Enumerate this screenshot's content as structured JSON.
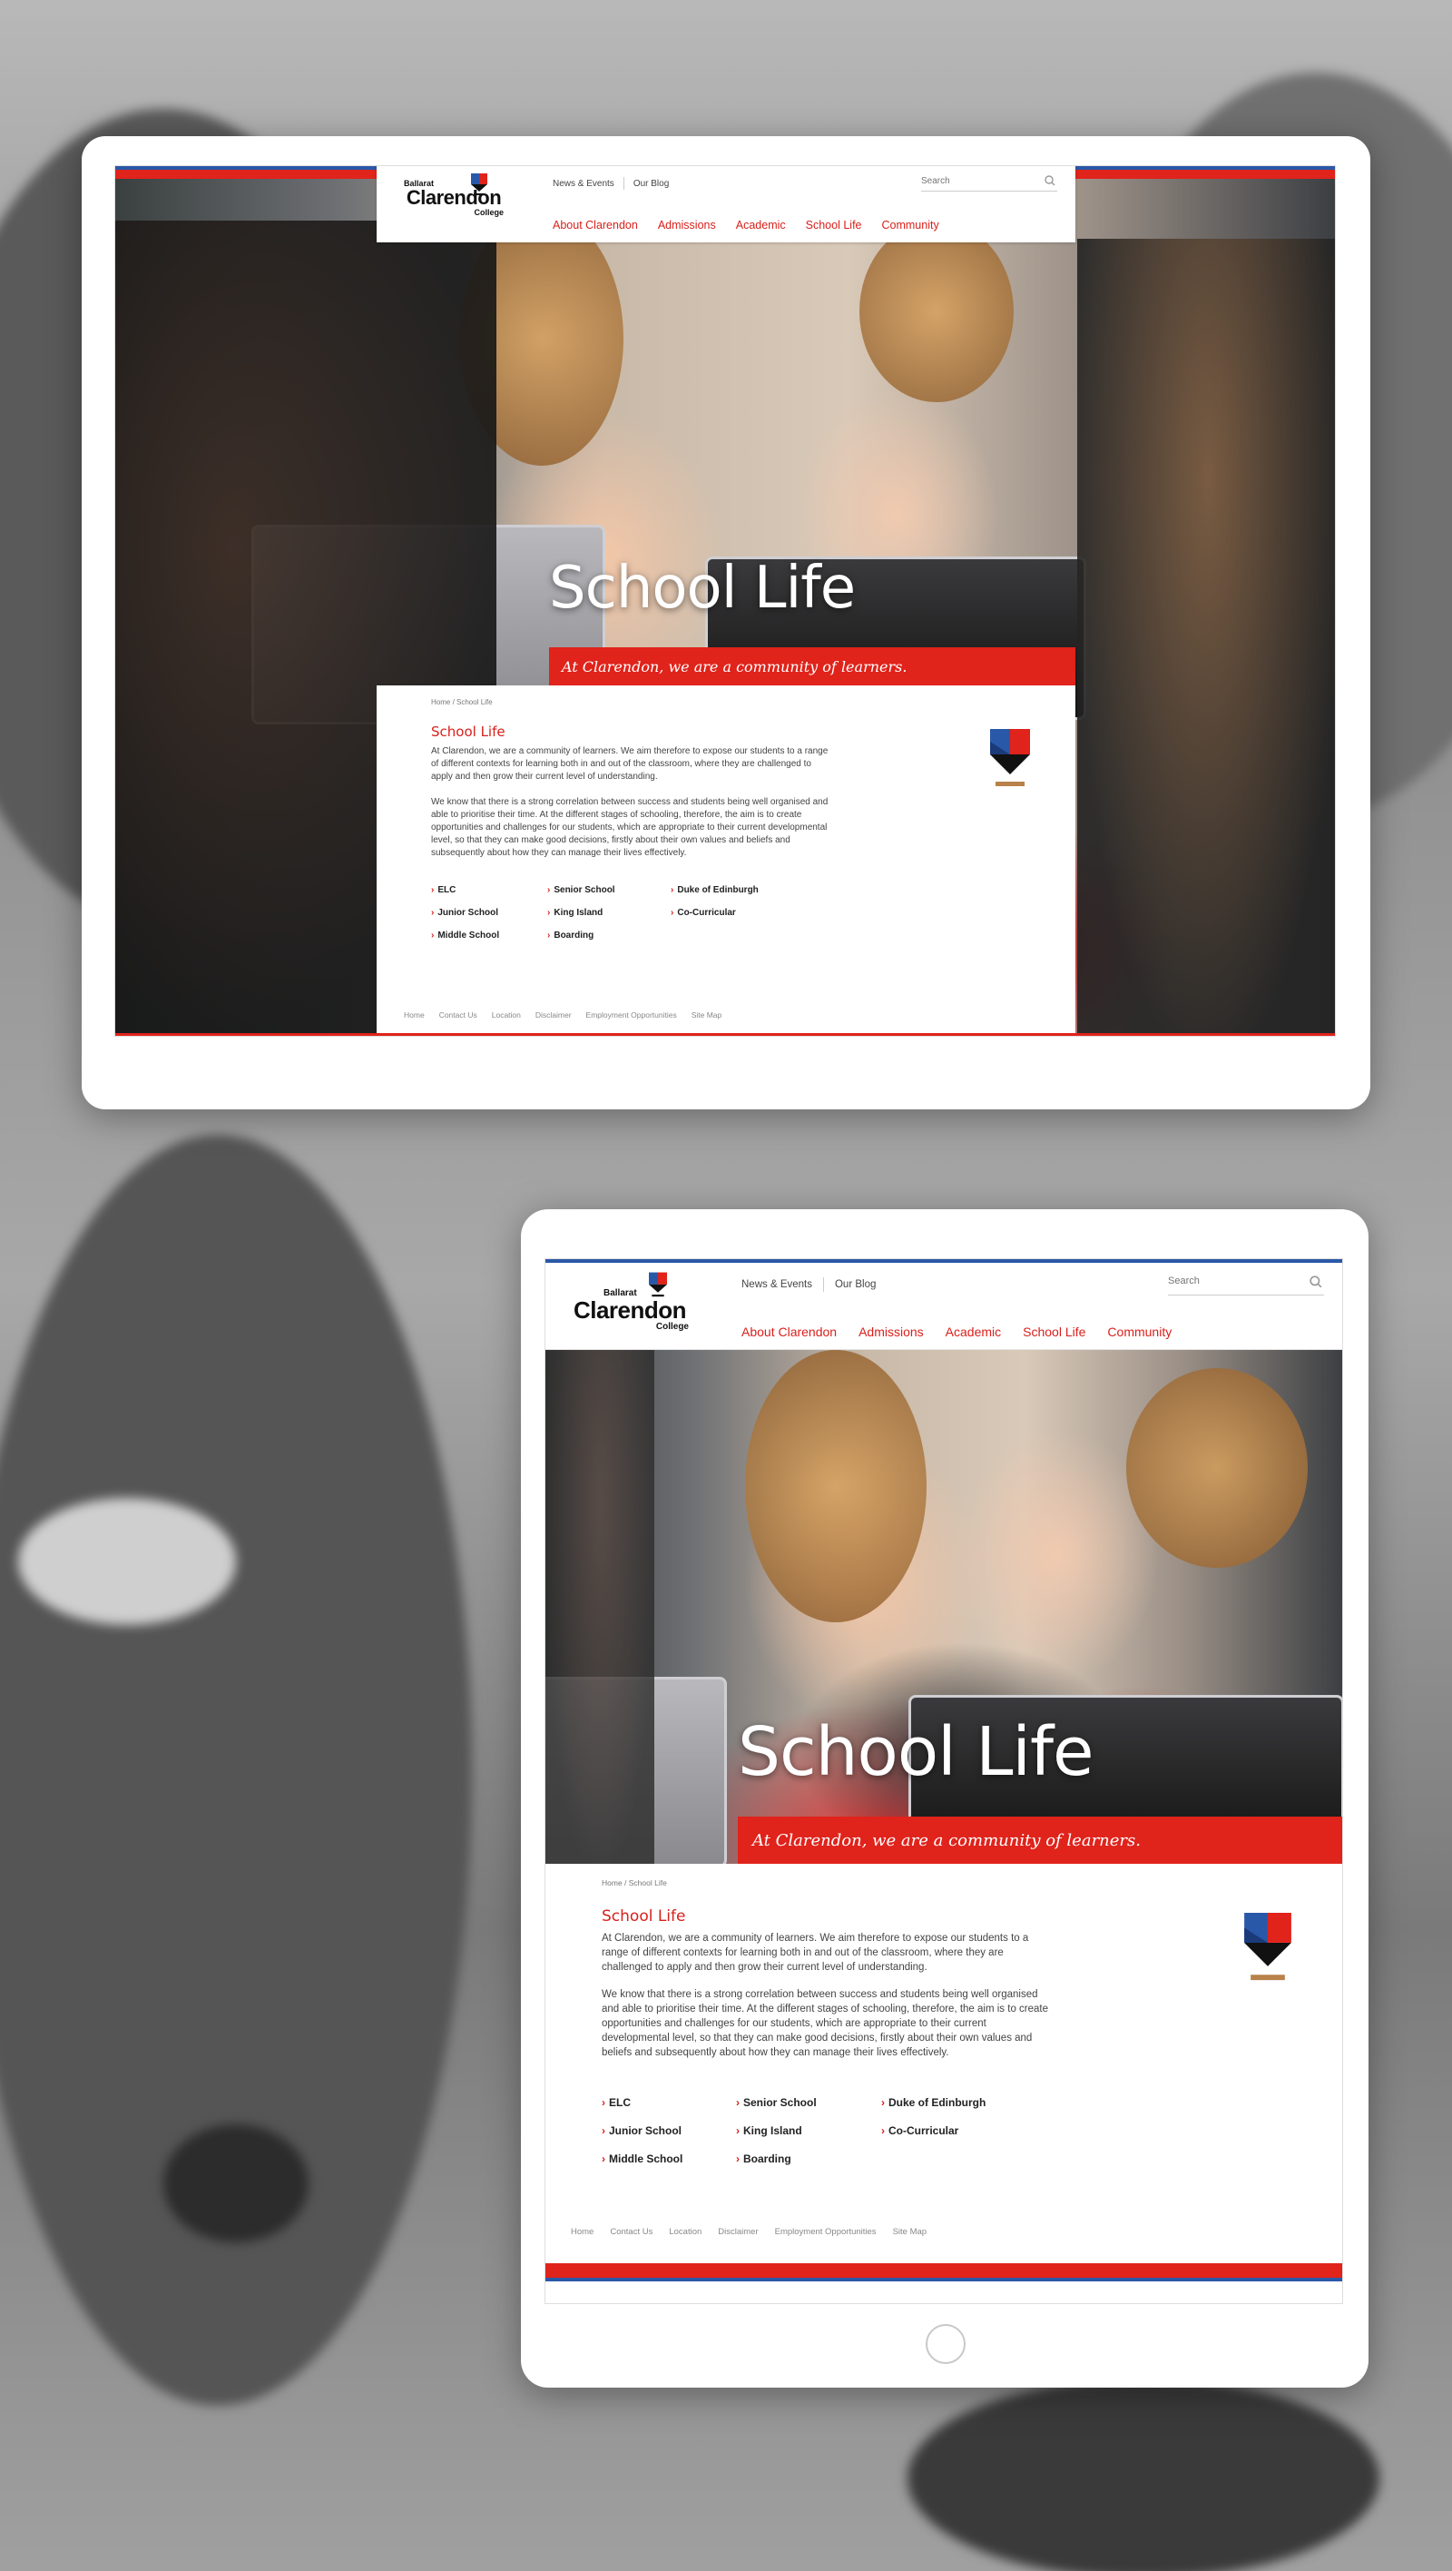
{
  "site": {
    "logo_top": "Ballarat",
    "logo_main": "Clarendon",
    "logo_bottom": "College",
    "utility_links": [
      "News & Events",
      "Our Blog"
    ],
    "search_placeholder": "Search",
    "main_nav": [
      "About Clarendon",
      "Admissions",
      "Academic",
      "School Life",
      "Community"
    ],
    "hero_title": "School Life",
    "hero_tagline": "At Clarendon, we are a community of learners.",
    "breadcrumb": "Home  /  School Life",
    "page_heading": "School Life",
    "paragraph_1": "At Clarendon, we are a community of learners. We aim therefore to expose our students to a range of different contexts for learning both in and out of the classroom, where they are challenged to apply and then grow their current level of understanding.",
    "paragraph_2": "We know that there is a strong correlation between success and students being well organised and able to prioritise their time. At the different stages of schooling, therefore, the aim is to create opportunities and challenges for our students, which are appropriate to their current developmental level, so that they can make good decisions, firstly about their own values and beliefs and subsequently about how they can manage their lives effectively.",
    "section_links": [
      "ELC",
      "Senior School",
      "Duke of Edinburgh",
      "Junior School",
      "King Island",
      "Co-Curricular",
      "Middle School",
      "Boarding"
    ],
    "footer_links": [
      "Home",
      "Contact Us",
      "Location",
      "Disclaimer",
      "Employment Opportunities",
      "Site Map"
    ]
  },
  "colors": {
    "brand_red": "#e0231b",
    "brand_blue": "#2a58a8",
    "link_red": "#d8201b"
  },
  "icons": [
    "shield-crest-icon",
    "search-icon",
    "chevron-right-icon",
    "home-button"
  ]
}
